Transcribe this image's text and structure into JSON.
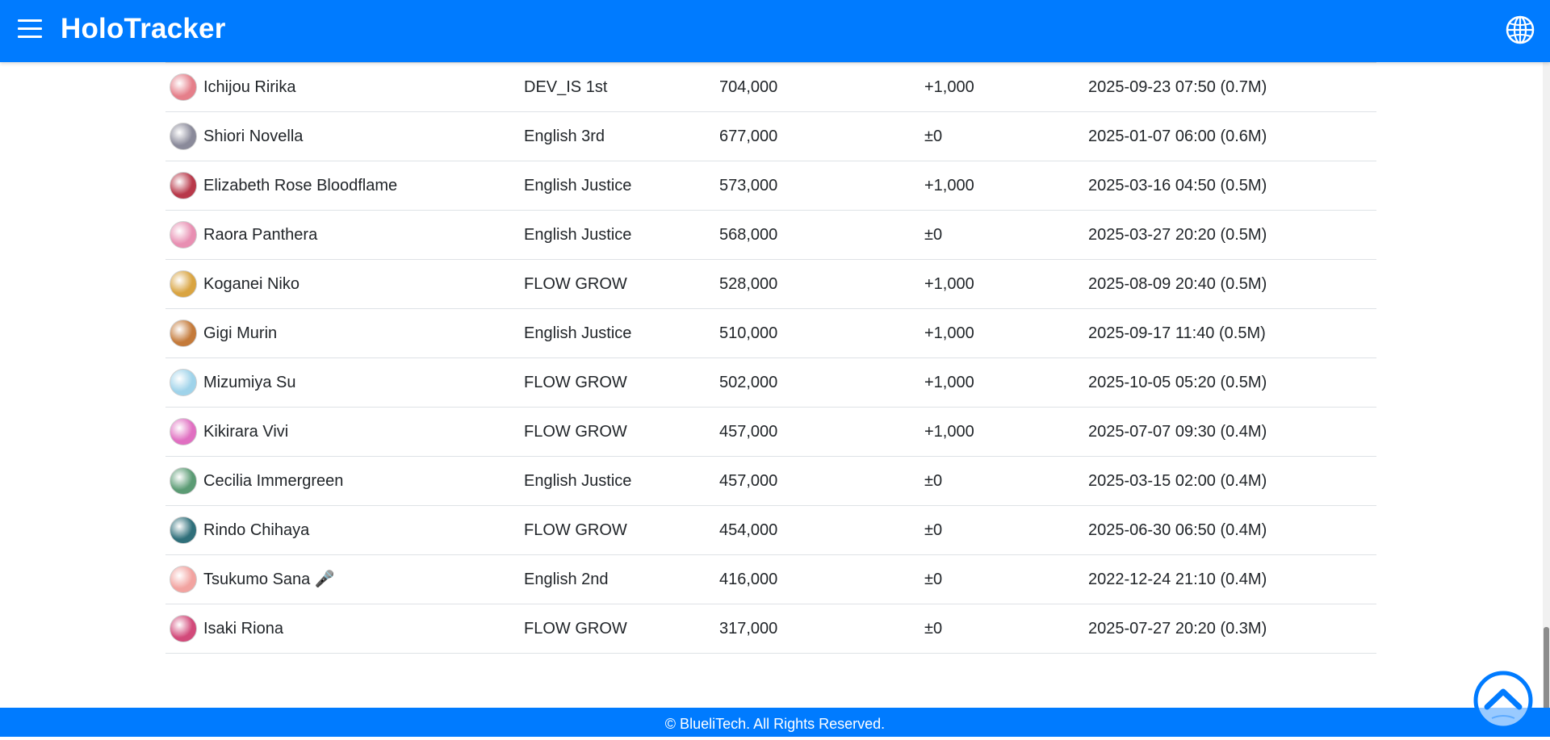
{
  "header": {
    "brand": "HoloTracker",
    "menu_icon": "hamburger-menu-icon",
    "language_icon": "globe-icon"
  },
  "colors": {
    "primary": "#007bff",
    "row_border": "#dee2e6",
    "text": "#212529"
  },
  "table": {
    "rows": [
      {
        "name": "Ichijou Ririka",
        "branch": "DEV_IS 1st",
        "subscribers": "704,000",
        "change": "+1,000",
        "milestone": "2025-09-23 07:50 (0.7M)",
        "avatar_color": "#e57f8a"
      },
      {
        "name": "Shiori Novella",
        "branch": "English 3rd",
        "subscribers": "677,000",
        "change": "±0",
        "milestone": "2025-01-07 06:00 (0.6M)",
        "avatar_color": "#8a8a9a"
      },
      {
        "name": "Elizabeth Rose Bloodflame",
        "branch": "English Justice",
        "subscribers": "573,000",
        "change": "+1,000",
        "milestone": "2025-03-16 04:50 (0.5M)",
        "avatar_color": "#b8394a"
      },
      {
        "name": "Raora Panthera",
        "branch": "English Justice",
        "subscribers": "568,000",
        "change": "±0",
        "milestone": "2025-03-27 20:20 (0.5M)",
        "avatar_color": "#e88fb2"
      },
      {
        "name": "Koganei Niko",
        "branch": "FLOW GROW",
        "subscribers": "528,000",
        "change": "+1,000",
        "milestone": "2025-08-09 20:40 (0.5M)",
        "avatar_color": "#d9a441"
      },
      {
        "name": "Gigi Murin",
        "branch": "English Justice",
        "subscribers": "510,000",
        "change": "+1,000",
        "milestone": "2025-09-17 11:40 (0.5M)",
        "avatar_color": "#c47a3a"
      },
      {
        "name": "Mizumiya Su",
        "branch": "FLOW GROW",
        "subscribers": "502,000",
        "change": "+1,000",
        "milestone": "2025-10-05 05:20 (0.5M)",
        "avatar_color": "#9fd3ea"
      },
      {
        "name": "Kikirara Vivi",
        "branch": "FLOW GROW",
        "subscribers": "457,000",
        "change": "+1,000",
        "milestone": "2025-07-07 09:30 (0.4M)",
        "avatar_color": "#e06fc1"
      },
      {
        "name": "Cecilia Immergreen",
        "branch": "English Justice",
        "subscribers": "457,000",
        "change": "±0",
        "milestone": "2025-03-15 02:00 (0.4M)",
        "avatar_color": "#5b9b74"
      },
      {
        "name": "Rindo Chihaya",
        "branch": "FLOW GROW",
        "subscribers": "454,000",
        "change": "±0",
        "milestone": "2025-06-30 06:50 (0.4M)",
        "avatar_color": "#2f6f7a"
      },
      {
        "name": "Tsukumo Sana 🎤",
        "branch": "English 2nd",
        "subscribers": "416,000",
        "change": "±0",
        "milestone": "2022-12-24 21:10 (0.4M)",
        "avatar_color": "#f2a3a0"
      },
      {
        "name": "Isaki Riona",
        "branch": "FLOW GROW",
        "subscribers": "317,000",
        "change": "±0",
        "milestone": "2025-07-27 20:20 (0.3M)",
        "avatar_color": "#d24a7a"
      }
    ]
  },
  "footer": {
    "copyright": "© BlueliTech. All Rights Reserved."
  },
  "back_to_top": {
    "icon": "chevron-up-icon"
  }
}
